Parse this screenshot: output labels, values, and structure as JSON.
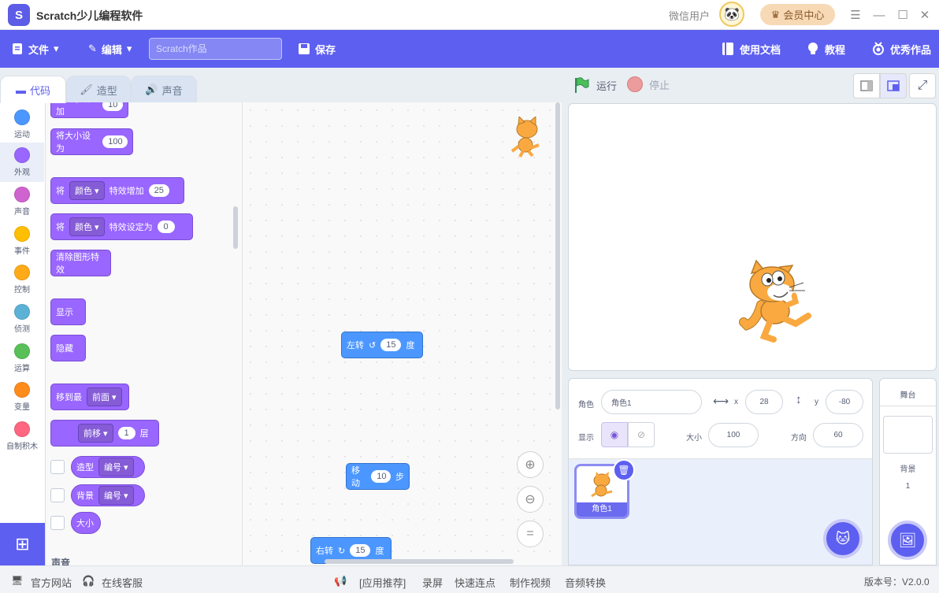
{
  "app": {
    "title": "Scratch少儿编程软件",
    "logo_letter": "S"
  },
  "titlebar": {
    "username": "微信用户",
    "vip_label": "会员中心"
  },
  "menubar": {
    "file_label": "文件",
    "edit_label": "编辑",
    "project_name_placeholder": "Scratch作品",
    "save_label": "保存",
    "docs_label": "使用文档",
    "tutorial_label": "教程",
    "showcase_label": "优秀作品"
  },
  "tabs": {
    "code": "代码",
    "costumes": "造型",
    "sounds": "声音"
  },
  "categories": [
    {
      "label": "运动",
      "color": "#4c97ff"
    },
    {
      "label": "外观",
      "color": "#9966ff"
    },
    {
      "label": "声音",
      "color": "#cf63cf"
    },
    {
      "label": "事件",
      "color": "#ffbf00"
    },
    {
      "label": "控制",
      "color": "#ffab19"
    },
    {
      "label": "侦测",
      "color": "#5cb1d6"
    },
    {
      "label": "运算",
      "color": "#59c059"
    },
    {
      "label": "变量",
      "color": "#ff8c1a"
    },
    {
      "label": "自制积木",
      "color": "#ff6680"
    }
  ],
  "palette": {
    "change_size_label": "将大小增加",
    "change_size_value": "10",
    "set_size_label": "将大小设为",
    "set_size_value": "100",
    "change_effect_prefix": "将",
    "change_effect_dd": "颜色",
    "change_effect_label": "特效增加",
    "change_effect_value": "25",
    "set_effect_prefix": "将",
    "set_effect_dd": "颜色",
    "set_effect_label": "特效设定为",
    "set_effect_value": "0",
    "clear_effects_label": "清除图形特效",
    "show_label": "显示",
    "hide_label": "隐藏",
    "goto_layer_label": "移到最",
    "goto_layer_dd": "前面",
    "go_layers_dd": "前移",
    "go_layers_value": "1",
    "go_layers_suffix": "层",
    "costume_reporter_label": "造型",
    "costume_reporter_dd": "编号",
    "backdrop_reporter_label": "背景",
    "backdrop_reporter_dd": "编号",
    "size_reporter_label": "大小",
    "section_sound_label": "声音"
  },
  "code": {
    "turn_left_label": "左转",
    "turn_left_value": "15",
    "turn_left_unit": "度",
    "move_label": "移动",
    "move_value": "10",
    "move_unit": "步",
    "turn_right_label": "右转",
    "turn_right_value": "15",
    "turn_right_unit": "度"
  },
  "stage_controls": {
    "run_label": "运行",
    "stop_label": "停止"
  },
  "sprite_info": {
    "sprite_label": "角色",
    "sprite_name": "角色1",
    "x_label": "x",
    "x_value": "28",
    "y_label": "y",
    "y_value": "-80",
    "show_label": "显示",
    "size_label": "大小",
    "size_value": "100",
    "direction_label": "方向",
    "direction_value": "60"
  },
  "sprite_list": [
    {
      "name": "角色1"
    }
  ],
  "stage_panel": {
    "title": "舞台",
    "backdrop_label": "背景",
    "backdrop_count": "1"
  },
  "statusbar": {
    "website_label": "官方网站",
    "support_label": "在线客服",
    "recommend_label": "[应用推荐]",
    "links": [
      "录屏",
      "快速连点",
      "制作视频",
      "音频转换"
    ],
    "version": "版本号：V2.0.0"
  },
  "colors": {
    "accent": "#5d5ff0",
    "looks": "#9966ff",
    "motion": "#4c97ff"
  }
}
